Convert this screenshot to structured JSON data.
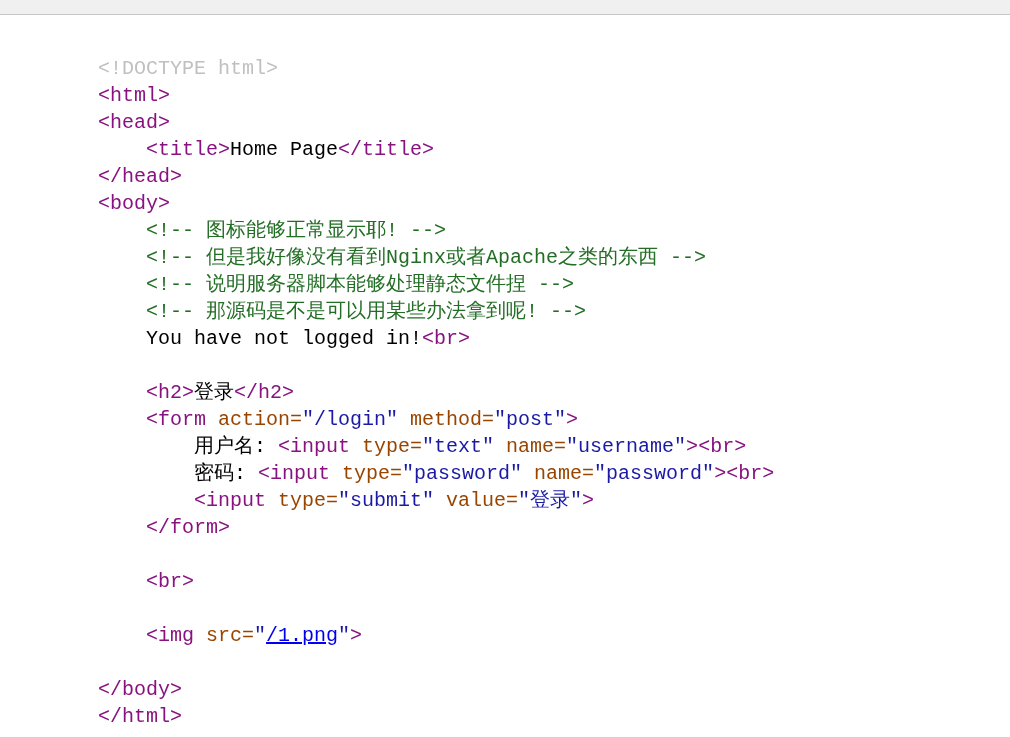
{
  "source_lines": [
    {
      "kind": "code",
      "tokens": [
        {
          "kind": "doctype",
          "text": "<!DOCTYPE html>"
        }
      ]
    },
    {
      "kind": "code",
      "tokens": [
        {
          "kind": "tag",
          "text": "<html>"
        }
      ]
    },
    {
      "kind": "code",
      "tokens": [
        {
          "kind": "tag",
          "text": "<head>"
        }
      ],
      "children": [
        {
          "kind": "code",
          "tokens": [
            {
              "kind": "tag",
              "text": "<title>"
            },
            {
              "kind": "text",
              "text": "Home Page"
            },
            {
              "kind": "tag",
              "text": "</title>"
            }
          ]
        }
      ]
    },
    {
      "kind": "code",
      "tokens": [
        {
          "kind": "tag",
          "text": "</head>"
        }
      ]
    },
    {
      "kind": "code",
      "tokens": [
        {
          "kind": "tag",
          "text": "<body>"
        }
      ],
      "children": [
        {
          "kind": "code",
          "tokens": [
            {
              "kind": "comment",
              "text": "<!-- 图标能够正常显示耶! -->"
            }
          ]
        },
        {
          "kind": "code",
          "tokens": [
            {
              "kind": "comment",
              "text": "<!-- 但是我好像没有看到Nginx或者Apache之类的东西 -->"
            }
          ]
        },
        {
          "kind": "code",
          "tokens": [
            {
              "kind": "comment",
              "text": "<!-- 说明服务器脚本能够处理静态文件捏 -->"
            }
          ]
        },
        {
          "kind": "code",
          "tokens": [
            {
              "kind": "comment",
              "text": "<!-- 那源码是不是可以用某些办法拿到呢! -->"
            }
          ]
        },
        {
          "kind": "code",
          "tokens": [
            {
              "kind": "text",
              "text": "You have not logged in!"
            },
            {
              "kind": "tag",
              "text": "<br>"
            }
          ]
        },
        {
          "kind": "blank"
        },
        {
          "kind": "code",
          "tokens": [
            {
              "kind": "tag",
              "text": "<h2>"
            },
            {
              "kind": "text",
              "text": "登录"
            },
            {
              "kind": "tag",
              "text": "</h2>"
            }
          ]
        },
        {
          "kind": "code",
          "tokens": [
            {
              "kind": "tag",
              "text": "<form "
            },
            {
              "kind": "attr",
              "text": "action="
            },
            {
              "kind": "value",
              "text": "\"/login\""
            },
            {
              "kind": "attr",
              "text": " method="
            },
            {
              "kind": "value",
              "text": "\"post\""
            },
            {
              "kind": "tag",
              "text": ">"
            }
          ],
          "children": [
            {
              "kind": "code",
              "tokens": [
                {
                  "kind": "text",
                  "text": "用户名: "
                },
                {
                  "kind": "tag",
                  "text": "<input "
                },
                {
                  "kind": "attr",
                  "text": "type="
                },
                {
                  "kind": "value",
                  "text": "\"text\""
                },
                {
                  "kind": "attr",
                  "text": " name="
                },
                {
                  "kind": "value",
                  "text": "\"username\""
                },
                {
                  "kind": "tag",
                  "text": ">"
                },
                {
                  "kind": "tag",
                  "text": "<br>"
                }
              ]
            },
            {
              "kind": "code",
              "tokens": [
                {
                  "kind": "text",
                  "text": "密码: "
                },
                {
                  "kind": "tag",
                  "text": "<input "
                },
                {
                  "kind": "attr",
                  "text": "type="
                },
                {
                  "kind": "value",
                  "text": "\"password\""
                },
                {
                  "kind": "attr",
                  "text": " name="
                },
                {
                  "kind": "value",
                  "text": "\"password\""
                },
                {
                  "kind": "tag",
                  "text": ">"
                },
                {
                  "kind": "tag",
                  "text": "<br>"
                }
              ]
            },
            {
              "kind": "code",
              "tokens": [
                {
                  "kind": "tag",
                  "text": "<input "
                },
                {
                  "kind": "attr",
                  "text": "type="
                },
                {
                  "kind": "value",
                  "text": "\"submit\""
                },
                {
                  "kind": "attr",
                  "text": " value="
                },
                {
                  "kind": "value",
                  "text": "\"登录\""
                },
                {
                  "kind": "tag",
                  "text": ">"
                }
              ]
            }
          ]
        },
        {
          "kind": "code",
          "tokens": [
            {
              "kind": "tag",
              "text": "</form>"
            }
          ]
        },
        {
          "kind": "blank"
        },
        {
          "kind": "code",
          "tokens": [
            {
              "kind": "tag",
              "text": "<br>"
            }
          ]
        },
        {
          "kind": "blank"
        },
        {
          "kind": "code",
          "tokens": [
            {
              "kind": "tag",
              "text": "<img "
            },
            {
              "kind": "attr",
              "text": "src="
            },
            {
              "kind": "value",
              "text": "\""
            },
            {
              "kind": "link",
              "text": "/1.png"
            },
            {
              "kind": "value",
              "text": "\""
            },
            {
              "kind": "tag",
              "text": ">"
            }
          ]
        },
        {
          "kind": "blank"
        }
      ]
    },
    {
      "kind": "code",
      "tokens": [
        {
          "kind": "tag",
          "text": "</body>"
        }
      ]
    },
    {
      "kind": "code",
      "tokens": [
        {
          "kind": "tag",
          "text": "</html>"
        }
      ]
    }
  ]
}
